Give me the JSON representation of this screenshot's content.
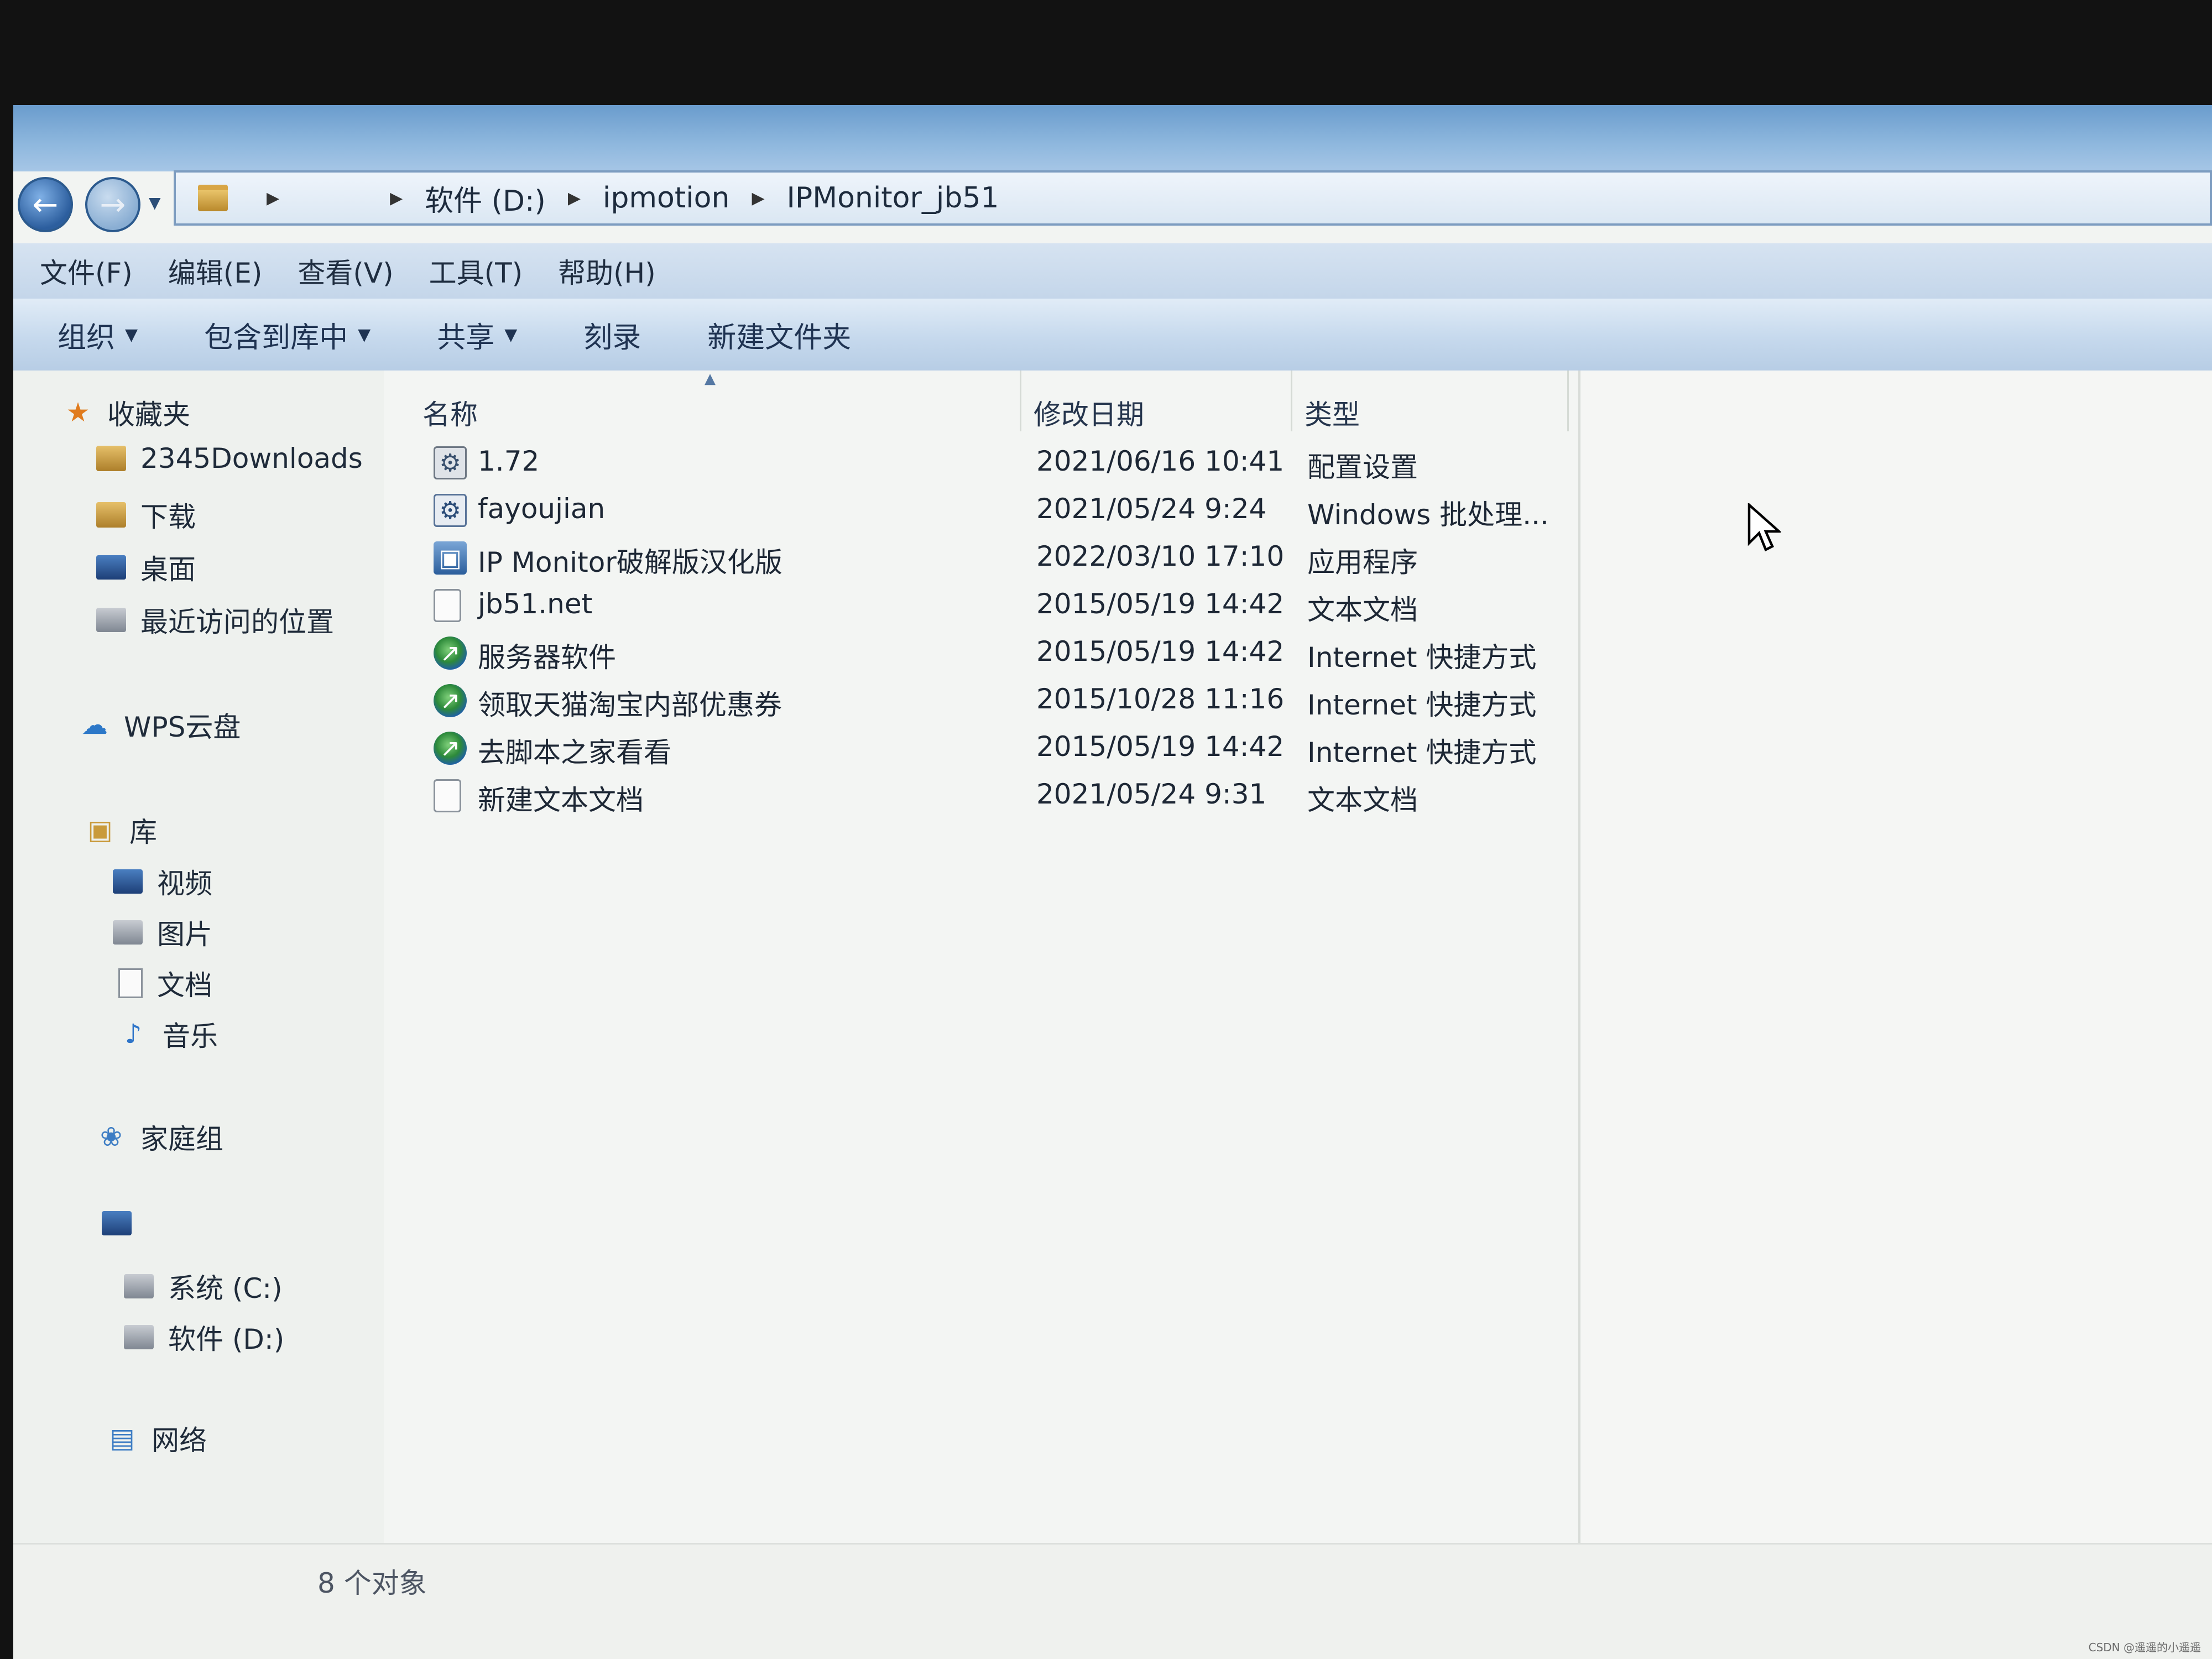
{
  "address": {
    "breadcrumbs": [
      "软件 (D:)",
      "ipmotion",
      "IPMonitor_jb51"
    ]
  },
  "menu": [
    "文件(F)",
    "编辑(E)",
    "查看(V)",
    "工具(T)",
    "帮助(H)"
  ],
  "toolbar": {
    "organize": "组织",
    "include_in_library": "包含到库中",
    "share": "共享",
    "burn": "刻录",
    "new_folder": "新建文件夹"
  },
  "sidebar": {
    "favorites": "收藏夹",
    "fav_items": [
      "2345Downloads",
      "下载",
      "桌面",
      "最近访问的位置"
    ],
    "wps": "WPS云盘",
    "library": "库",
    "lib_items": [
      "视频",
      "图片",
      "文档",
      "音乐"
    ],
    "homegroup": "家庭组",
    "drives": [
      "系统 (C:)",
      "软件 (D:)"
    ],
    "network": "网络"
  },
  "columns": {
    "name": "名称",
    "modified": "修改日期",
    "type": "类型"
  },
  "files": [
    {
      "name": "1.72",
      "modified": "2021/06/16 10:41",
      "type": "配置设置",
      "icon": "settings-file-icon"
    },
    {
      "name": "fayoujian",
      "modified": "2021/05/24 9:24",
      "type": "Windows 批处理...",
      "icon": "batch-file-icon"
    },
    {
      "name": "IP Monitor破解版汉化版",
      "modified": "2022/03/10 17:10",
      "type": "应用程序",
      "icon": "application-icon"
    },
    {
      "name": "jb51.net",
      "modified": "2015/05/19 14:42",
      "type": "文本文档",
      "icon": "text-file-icon"
    },
    {
      "name": "服务器软件",
      "modified": "2015/05/19 14:42",
      "type": "Internet 快捷方式",
      "icon": "internet-shortcut-icon"
    },
    {
      "name": "领取天猫淘宝内部优惠券",
      "modified": "2015/10/28 11:16",
      "type": "Internet 快捷方式",
      "icon": "internet-shortcut-icon"
    },
    {
      "name": "去脚本之家看看",
      "modified": "2015/05/19 14:42",
      "type": "Internet 快捷方式",
      "icon": "internet-shortcut-icon"
    },
    {
      "name": "新建文本文档",
      "modified": "2021/05/24 9:31",
      "type": "文本文档",
      "icon": "text-file-icon"
    }
  ],
  "status": "8 个对象",
  "watermark": "CSDN @遥遥的小遥遥"
}
